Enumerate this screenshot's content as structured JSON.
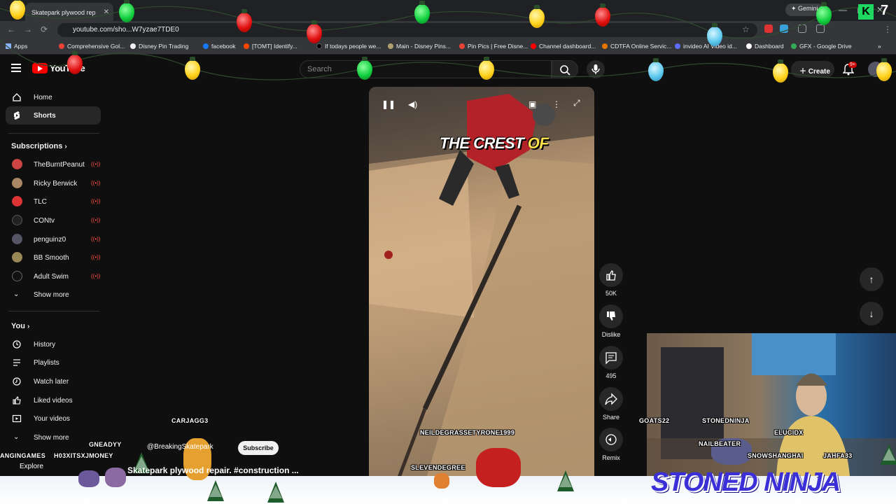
{
  "browser": {
    "tab_title": "Skatepark plywood rep",
    "tab_close": "✕",
    "url": "youtube.com/sho...W7yzae7TDE0",
    "gemini_label": "✦ Gemini",
    "window_controls": [
      "—",
      "▢",
      "✕"
    ]
  },
  "bookmarks": [
    {
      "label": "Apps",
      "color": "#8ab4f8"
    },
    {
      "label": "Comprehensive Gol...",
      "color": "#ea4335"
    },
    {
      "label": "Disney Pin Trading",
      "color": "#f1f1f1"
    },
    {
      "label": "facebook",
      "color": "#1877f2"
    },
    {
      "label": "[TOMT] Identify...",
      "color": "#ff4500"
    },
    {
      "label": "If todays people we...",
      "color": "#000000"
    },
    {
      "label": "Main - Disney Pins...",
      "color": "#b0a070"
    },
    {
      "label": "Pin Pics | Free Disne...",
      "color": "#ea4335"
    },
    {
      "label": "Channel dashboard...",
      "color": "#ff0000"
    },
    {
      "label": "CDTFA Online Servic...",
      "color": "#e37400"
    },
    {
      "label": "invideo AI Video id...",
      "color": "#5b6cff"
    },
    {
      "label": "Dashboard",
      "color": "#ffffff"
    },
    {
      "label": "GFX - Google Drive",
      "color": "#34a853"
    }
  ],
  "youtube": {
    "logo_text": "YouTube",
    "search_placeholder": "Search",
    "create_label": "Create",
    "notification_count": "9+"
  },
  "sidebar": {
    "main": [
      {
        "label": "Home",
        "icon": "home-icon"
      },
      {
        "label": "Shorts",
        "icon": "shorts-icon",
        "active": true
      }
    ],
    "subscriptions_heading": "Subscriptions",
    "subscriptions": [
      {
        "label": "TheBurntPeanut",
        "color": "#c44"
      },
      {
        "label": "Ricky Berwick",
        "color": "#a86"
      },
      {
        "label": "TLC",
        "color": "#d33"
      },
      {
        "label": "CONtv",
        "color": "#222"
      },
      {
        "label": "penguinz0",
        "color": "#556"
      },
      {
        "label": "BB Smooth",
        "color": "#985"
      },
      {
        "label": "Adult Swim",
        "color": "#111"
      }
    ],
    "show_more_1": "Show more",
    "you_heading": "You",
    "you_items": [
      {
        "label": "History",
        "icon": "history-icon"
      },
      {
        "label": "Playlists",
        "icon": "playlists-icon"
      },
      {
        "label": "Watch later",
        "icon": "watch-later-icon"
      },
      {
        "label": "Liked videos",
        "icon": "liked-videos-icon"
      },
      {
        "label": "Your videos",
        "icon": "your-videos-icon"
      }
    ],
    "show_more_2": "Show more",
    "explore_label": "Explore"
  },
  "video": {
    "caption_white": "THE CREST ",
    "caption_yellow": "OF",
    "channel_handle": "@BreakingSkatepark",
    "subscribe_label": "Subscribe",
    "title": "Skatepark plywood repair. #construction ..."
  },
  "actions": {
    "like_count": "50K",
    "dislike_label": "Dislike",
    "comment_count": "495",
    "share_label": "Share",
    "remix_label": "Remix"
  },
  "stream_overlay": {
    "names": [
      "CARJAGG3",
      "GNEADYY",
      "ANGINGAMES",
      "H03XITSXJMONEY",
      "NEILDEGRASSETYRONE1999",
      "SLEVENDEGREE",
      "GOATS22",
      "STONEDNINJA",
      "ELUCIDX",
      "NAILBEATER",
      "SNOWSHANGHAI",
      "JAHFA33"
    ],
    "streamer_brand": "STONED NINJA",
    "k_badge": "K",
    "k_number": "7"
  }
}
